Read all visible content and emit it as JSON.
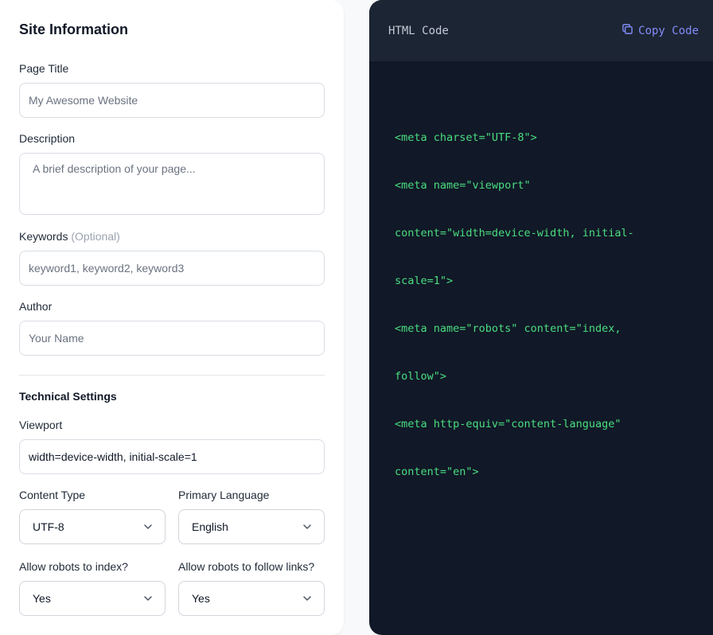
{
  "form": {
    "section_title": "Site Information",
    "page_title": {
      "label": "Page Title",
      "placeholder": "My Awesome Website"
    },
    "description": {
      "label": "Description",
      "placeholder": "A brief description of your page..."
    },
    "keywords": {
      "label": "Keywords",
      "optional": "(Optional)",
      "placeholder": "keyword1, keyword2, keyword3"
    },
    "author": {
      "label": "Author",
      "placeholder": "Your Name"
    },
    "technical_title": "Technical Settings",
    "viewport": {
      "label": "Viewport",
      "value": "width=device-width, initial-scale=1"
    },
    "content_type": {
      "label": "Content Type",
      "value": "UTF-8"
    },
    "language": {
      "label": "Primary Language",
      "value": "English"
    },
    "robots_index": {
      "label": "Allow robots to index?",
      "value": "Yes"
    },
    "robots_follow": {
      "label": "Allow robots to follow links?",
      "value": "Yes"
    }
  },
  "code_panel": {
    "title": "HTML Code",
    "copy_label": "Copy Code",
    "copy_icon": "copy-icon",
    "lines": [
      "<meta charset=\"UTF-8\">",
      "<meta name=\"viewport\"",
      "content=\"width=device-width, initial-",
      "scale=1\">",
      "<meta name=\"robots\" content=\"index,",
      "follow\">",
      "<meta http-equiv=\"content-language\"",
      "content=\"en\">"
    ]
  },
  "colors": {
    "accent": "#818cf8",
    "code_text": "#4ade80",
    "code_bg": "#111827",
    "code_header_bg": "#1c2533"
  }
}
